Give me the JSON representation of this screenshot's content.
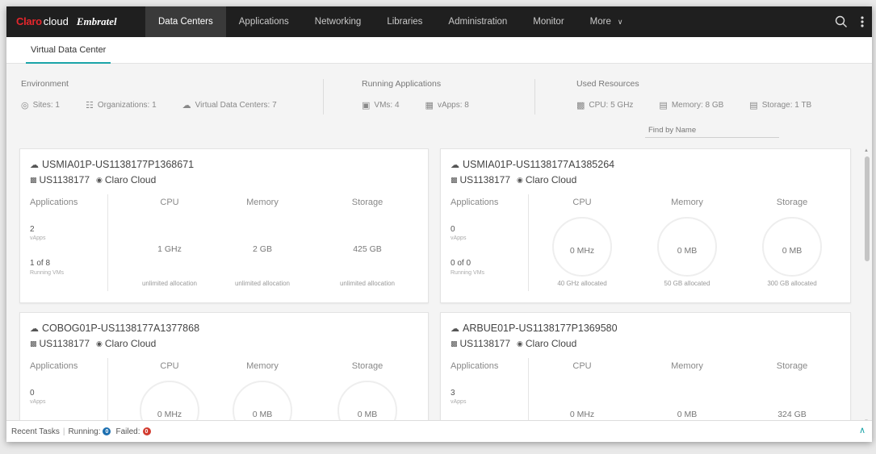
{
  "brand": {
    "claro": "Claro",
    "cloud": "cloud",
    "embratel": "Embratel"
  },
  "nav": {
    "items": [
      {
        "label": "Data Centers",
        "active": true
      },
      {
        "label": "Applications",
        "active": false
      },
      {
        "label": "Networking",
        "active": false
      },
      {
        "label": "Libraries",
        "active": false
      },
      {
        "label": "Administration",
        "active": false
      },
      {
        "label": "Monitor",
        "active": false
      },
      {
        "label": "More",
        "active": false
      }
    ]
  },
  "subnav": {
    "tab": "Virtual Data Center"
  },
  "summary": {
    "environment": {
      "title": "Environment",
      "sites": "Sites: 1",
      "organizations": "Organizations: 1",
      "vdcs": "Virtual Data Centers: 7"
    },
    "running": {
      "title": "Running Applications",
      "vms": "VMs: 4",
      "vapps": "vApps: 8"
    },
    "resources": {
      "title": "Used Resources",
      "cpu": "CPU: 5 GHz",
      "memory": "Memory: 8 GB",
      "storage": "Storage: 1 TB"
    }
  },
  "search": {
    "placeholder": "Find by Name"
  },
  "columns": {
    "applications": "Applications",
    "cpu": "CPU",
    "memory": "Memory",
    "storage": "Storage"
  },
  "cards": [
    {
      "name": "USMIA01P-US1138177P1368671",
      "org": "US1138177",
      "site": "Claro Cloud",
      "apps": "2",
      "apps_label": "vApps",
      "vms": "1 of 8",
      "vms_label": "Running VMs",
      "cpu": "1 GHz",
      "memory": "2 GB",
      "storage": "425 GB",
      "cpu_alloc": "unlimited allocation",
      "memory_alloc": "unlimited allocation",
      "storage_alloc": "unlimited allocation"
    },
    {
      "name": "USMIA01P-US1138177A1385264",
      "org": "US1138177",
      "site": "Claro Cloud",
      "apps": "0",
      "apps_label": "vApps",
      "vms": "0 of 0",
      "vms_label": "Running VMs",
      "cpu": "0 MHz",
      "memory": "0 MB",
      "storage": "0 MB",
      "cpu_alloc": "40 GHz allocated",
      "memory_alloc": "50 GB allocated",
      "storage_alloc": "300 GB allocated"
    },
    {
      "name": "COBOG01P-US1138177A1377868",
      "org": "US1138177",
      "site": "Claro Cloud",
      "apps": "0",
      "apps_label": "vApps",
      "cpu": "0 MHz",
      "memory": "0 MB",
      "storage": "0 MB"
    },
    {
      "name": "ARBUE01P-US1138177P1369580",
      "org": "US1138177",
      "site": "Claro Cloud",
      "apps": "3",
      "apps_label": "vApps",
      "cpu": "0 MHz",
      "memory": "0 MB",
      "storage": "324 GB"
    }
  ],
  "footer": {
    "recent": "Recent Tasks",
    "running": "Running:",
    "running_count": "0",
    "failed": "Failed:",
    "failed_count": "0"
  },
  "colors": {
    "accent": "#1ba4a8",
    "topbar": "#1f1f1f",
    "brand_red": "#e4262c",
    "running": "#1c6fb0",
    "failed": "#d23b2f"
  }
}
